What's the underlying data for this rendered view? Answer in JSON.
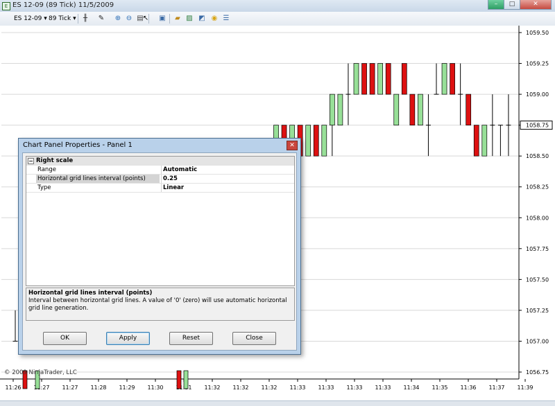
{
  "window": {
    "title": "ES 12-09 (89 Tick)  11/5/2009",
    "minimize": "–",
    "maximize": "□",
    "close": "✕"
  },
  "toolbar": {
    "instrument": "ES 12-09",
    "interval": "89 Tick",
    "icons": [
      "bar-style-icon",
      "draw-icon",
      "zoom-in-icon",
      "zoom-out-icon",
      "properties-icon",
      "cursor-icon",
      "data-box-icon",
      "folder-icon",
      "image-icon",
      "chart-icon",
      "clock-icon",
      "list-icon"
    ]
  },
  "chart_data": {
    "type": "candlestick",
    "y_axis": {
      "ticks": [
        "1059.50",
        "1059.25",
        "1059.00",
        "1058.75",
        "1058.50",
        "1058.25",
        "1058.00",
        "1057.75",
        "1057.50",
        "1057.25",
        "1057.00",
        "1056.75"
      ],
      "last_price_label": "1058.75"
    },
    "x_axis": {
      "ticks": [
        "11:26",
        "11:27",
        "11:27",
        "11:28",
        "11:29",
        "11:30",
        "11:31",
        "11:32",
        "11:32",
        "11:32",
        "11:33",
        "11:33",
        "11:33",
        "11:33",
        "11:34",
        "11:35",
        "11:36",
        "11:37",
        "11:39"
      ]
    },
    "colors": {
      "up": "#98e098",
      "down": "#dd1111",
      "outline": "#000000",
      "grid": "#d8d8d8"
    },
    "bars": [
      {
        "t": 0,
        "o": 1057.0,
        "h": 1057.25,
        "l": 1057.0,
        "c": 1057.0
      },
      {
        "t": 1,
        "o": 1056.75,
        "h": 1056.75,
        "l": 1056.75,
        "c": 1056.75
      },
      {
        "t": 2,
        "o": 1056.75,
        "h": 1056.75,
        "l": 1056.75,
        "c": 1056.75
      },
      {
        "t": 3,
        "o": 1056.75,
        "h": 1056.75,
        "l": 1056.75,
        "c": 1056.75
      },
      {
        "t": 4,
        "o": 1056.75,
        "h": 1056.75,
        "l": 1056.75,
        "c": 1056.75
      },
      {
        "t": 5,
        "o": 1056.75,
        "h": 1056.75,
        "l": 1056.75,
        "c": 1056.75
      },
      {
        "t": 6,
        "o": 1056.75,
        "h": 1056.75,
        "l": 1056.75,
        "c": 1056.75
      },
      {
        "t": 7,
        "o": 1056.75,
        "h": 1056.75,
        "l": 1056.75,
        "c": 1056.75
      },
      {
        "t": 8,
        "o": 1058.5,
        "h": 1058.75,
        "l": 1058.5,
        "c": 1058.75
      },
      {
        "t": 9,
        "o": 1058.75,
        "h": 1058.75,
        "l": 1058.5,
        "c": 1058.5
      },
      {
        "t": 10,
        "o": 1058.5,
        "h": 1058.75,
        "l": 1058.5,
        "c": 1058.75
      },
      {
        "t": 11,
        "o": 1058.75,
        "h": 1058.75,
        "l": 1058.5,
        "c": 1058.5
      },
      {
        "t": 12,
        "o": 1058.5,
        "h": 1058.75,
        "l": 1058.5,
        "c": 1058.75
      },
      {
        "t": 13,
        "o": 1058.75,
        "h": 1058.75,
        "l": 1058.5,
        "c": 1058.5
      },
      {
        "t": 14,
        "o": 1058.5,
        "h": 1058.75,
        "l": 1058.5,
        "c": 1058.75
      },
      {
        "t": 15,
        "o": 1058.75,
        "h": 1059.0,
        "l": 1058.5,
        "c": 1059.0
      },
      {
        "t": 16,
        "o": 1058.75,
        "h": 1059.0,
        "l": 1058.75,
        "c": 1059.0
      },
      {
        "t": 17,
        "o": 1059.0,
        "h": 1059.25,
        "l": 1058.75,
        "c": 1059.0
      },
      {
        "t": 18,
        "o": 1059.0,
        "h": 1059.25,
        "l": 1059.0,
        "c": 1059.25
      },
      {
        "t": 19,
        "o": 1059.25,
        "h": 1059.25,
        "l": 1059.0,
        "c": 1059.0
      },
      {
        "t": 20,
        "o": 1059.25,
        "h": 1059.25,
        "l": 1059.0,
        "c": 1059.0
      },
      {
        "t": 21,
        "o": 1059.0,
        "h": 1059.25,
        "l": 1059.0,
        "c": 1059.25
      },
      {
        "t": 22,
        "o": 1059.25,
        "h": 1059.25,
        "l": 1059.0,
        "c": 1059.0
      },
      {
        "t": 23,
        "o": 1058.75,
        "h": 1059.0,
        "l": 1058.75,
        "c": 1059.0
      },
      {
        "t": 24,
        "o": 1059.25,
        "h": 1059.25,
        "l": 1059.0,
        "c": 1059.0
      },
      {
        "t": 25,
        "o": 1059.0,
        "h": 1059.0,
        "l": 1058.75,
        "c": 1058.75
      },
      {
        "t": 26,
        "o": 1058.75,
        "h": 1059.0,
        "l": 1058.75,
        "c": 1059.0
      },
      {
        "t": 27,
        "o": 1058.75,
        "h": 1059.0,
        "l": 1058.5,
        "c": 1058.75
      },
      {
        "t": 28,
        "o": 1059.0,
        "h": 1059.25,
        "l": 1059.0,
        "c": 1059.0
      },
      {
        "t": 29,
        "o": 1059.0,
        "h": 1059.25,
        "l": 1059.0,
        "c": 1059.25
      },
      {
        "t": 30,
        "o": 1059.25,
        "h": 1059.25,
        "l": 1059.0,
        "c": 1059.0
      },
      {
        "t": 31,
        "o": 1059.0,
        "h": 1059.25,
        "l": 1058.75,
        "c": 1059.0
      },
      {
        "t": 32,
        "o": 1059.0,
        "h": 1059.0,
        "l": 1058.75,
        "c": 1058.75
      },
      {
        "t": 33,
        "o": 1058.75,
        "h": 1058.75,
        "l": 1058.5,
        "c": 1058.5
      },
      {
        "t": 34,
        "o": 1058.5,
        "h": 1058.75,
        "l": 1058.5,
        "c": 1058.75
      },
      {
        "t": 35,
        "o": 1058.75,
        "h": 1059.0,
        "l": 1058.5,
        "c": 1058.75
      },
      {
        "t": 36,
        "o": 1058.75,
        "h": 1058.75,
        "l": 1058.5,
        "c": 1058.75
      },
      {
        "t": 37,
        "o": 1058.75,
        "h": 1059.0,
        "l": 1058.5,
        "c": 1058.75
      }
    ]
  },
  "dialog": {
    "title": "Chart Panel Properties - Panel 1",
    "close": "✕",
    "category": "Right scale",
    "category_toggle": "⊟",
    "properties": [
      {
        "name": "Range",
        "value": "Automatic"
      },
      {
        "name": "Horizontal grid lines interval (points)",
        "value": "0.25"
      },
      {
        "name": "Type",
        "value": "Linear"
      }
    ],
    "description_title": "Horizontal grid lines interval (points)",
    "description_text": "Interval between horizontal grid lines. A value of '0' (zero) will use automatic horizontal grid line generation.",
    "buttons": {
      "ok": "OK",
      "apply": "Apply",
      "reset": "Reset",
      "close": "Close"
    }
  },
  "copyright": "© 2009 NinjaTrader, LLC"
}
